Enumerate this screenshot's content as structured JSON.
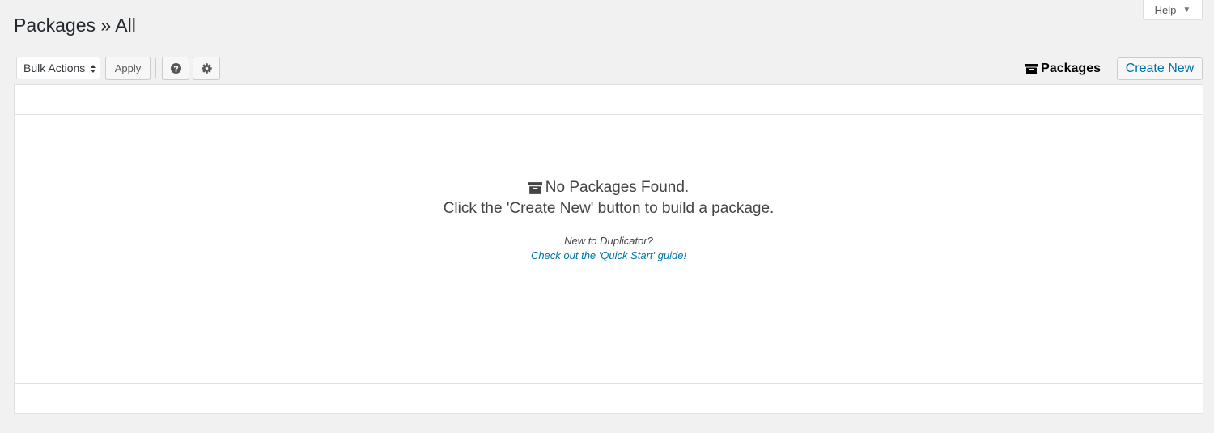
{
  "help_tab": {
    "label": "Help",
    "caret": "▼"
  },
  "page_title": "Packages » All",
  "toolbar": {
    "bulk_actions_label": "Bulk Actions",
    "apply_label": "Apply",
    "help_icon": "question-circle-icon",
    "settings_icon": "gear-icon"
  },
  "header_right": {
    "packages_label": "Packages",
    "packages_icon": "archive-icon",
    "create_new_label": "Create New"
  },
  "empty_state": {
    "icon": "archive-icon",
    "title": "No Packages Found.",
    "message": "Click the 'Create New' button to build a package.",
    "new_to": "New to Duplicator?",
    "guide_link": "Check out the 'Quick Start' guide!"
  },
  "colors": {
    "background": "#f1f1f1",
    "link": "#0073aa",
    "panel": "#ffffff",
    "text": "#23282d"
  }
}
